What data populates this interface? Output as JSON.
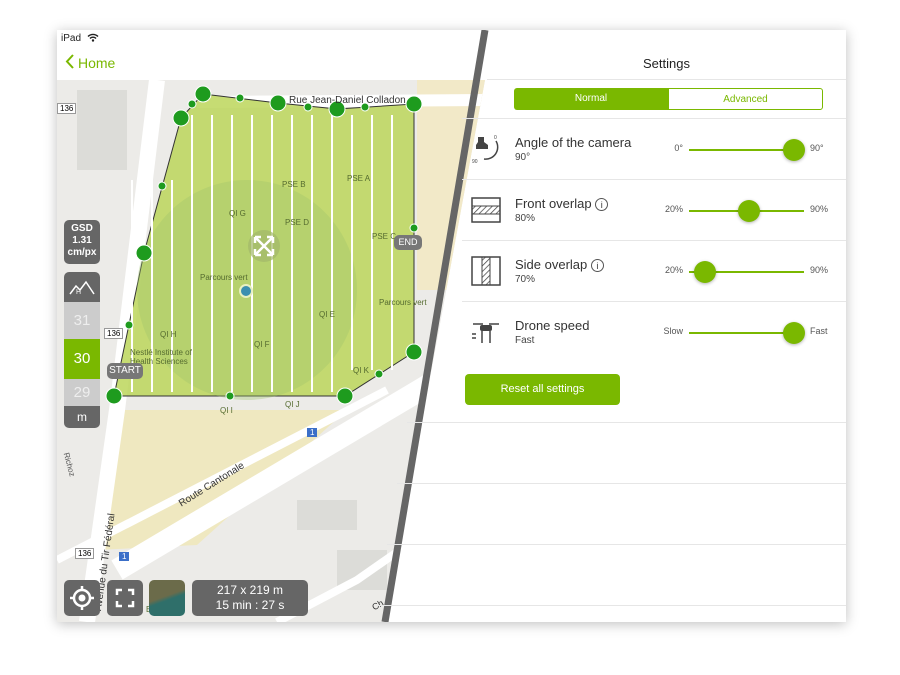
{
  "status_bar": {
    "device": "iPad",
    "wifi_icon": "wifi-icon"
  },
  "nav": {
    "back_label": "Home",
    "title": "Settings"
  },
  "tabs": [
    {
      "label": "Normal",
      "active": true
    },
    {
      "label": "Advanced",
      "active": false
    }
  ],
  "settings": [
    {
      "title": "Angle of the camera",
      "value": "90°",
      "min": "0°",
      "max": "90°",
      "level": 0.91,
      "icon": "camera-angle-icon",
      "icon_labels": [
        "0",
        "90"
      ]
    },
    {
      "title": "Front overlap",
      "value": "80%",
      "min": "20%",
      "max": "90%",
      "level": 0.52,
      "icon": "front-overlap-icon",
      "info": true
    },
    {
      "title": "Side overlap",
      "value": "70%",
      "min": "20%",
      "max": "90%",
      "level": 0.14,
      "icon": "side-overlap-icon",
      "info": true
    },
    {
      "title": "Drone speed",
      "value": "Fast",
      "min": "Slow",
      "max": "Fast",
      "level": 0.91,
      "icon": "drone-icon"
    }
  ],
  "reset_label": "Reset all settings",
  "map": {
    "street_labels": [
      "Rue Jean-Daniel Colladon",
      "Avenue du Tir Fédéral",
      "Route Cantonale",
      "Ch",
      "Richoz"
    ],
    "poi_labels": [
      "PSE B",
      "PSE A",
      "QI G",
      "PSE D",
      "PSE C",
      "Parcours vert",
      "Parcours vert",
      "QI E",
      "QI H",
      "QI F",
      "Nestlé Institute of Health Sciences",
      "QI K",
      "QI J",
      "QI I",
      "BP"
    ],
    "road_badges": [
      "136",
      "136",
      "136",
      "1",
      "1"
    ],
    "start_label": "START",
    "end_label": "END",
    "gsd": {
      "label": "GSD",
      "value": "1.31",
      "unit": "cm/px"
    },
    "altitude": {
      "above": "31",
      "current": "30",
      "below": "29",
      "unit": "m"
    },
    "area": "217 x 219 m",
    "duration": "15 min : 27 s",
    "accent": "#7ab800"
  }
}
